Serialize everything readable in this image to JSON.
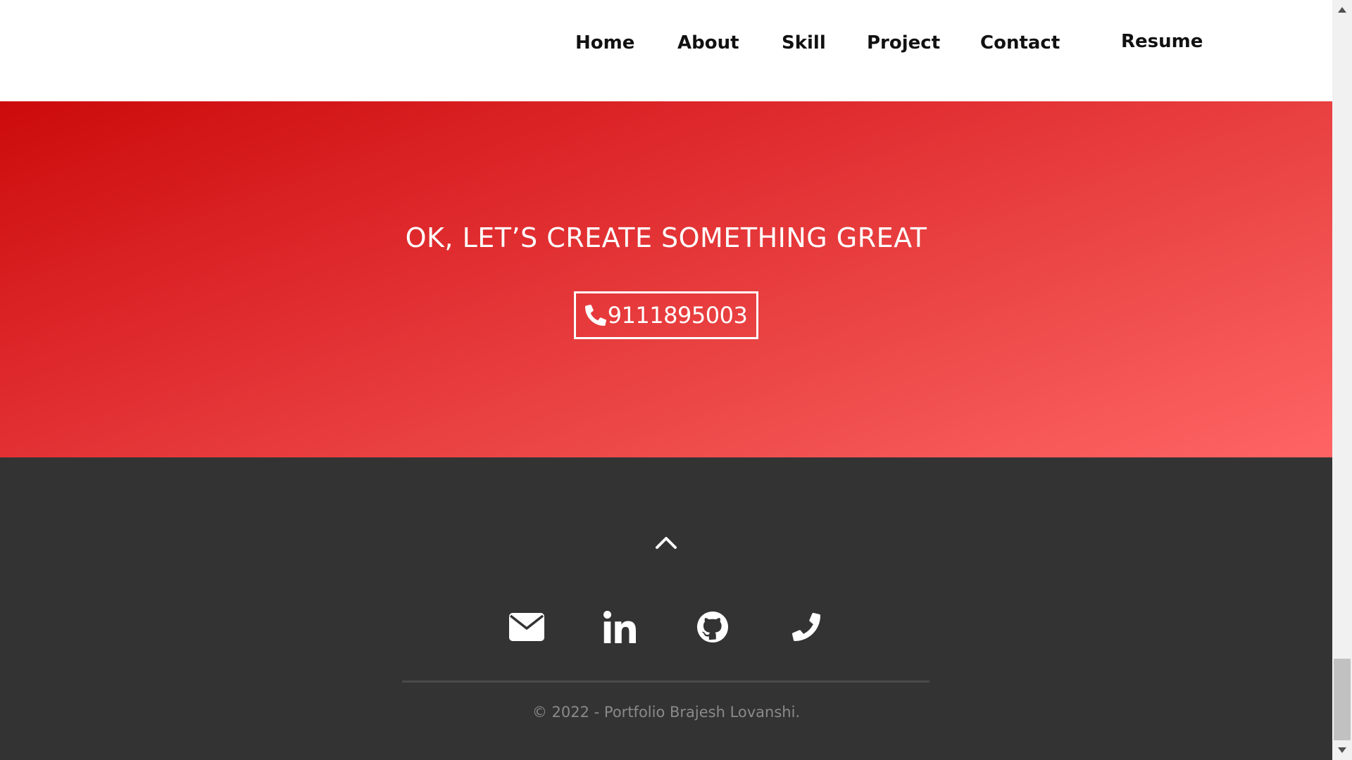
{
  "nav": {
    "items": [
      {
        "label": "Home"
      },
      {
        "label": "About"
      },
      {
        "label": "Skill"
      },
      {
        "label": "Project"
      },
      {
        "label": "Contact"
      }
    ],
    "resume_label": "Resume"
  },
  "cta": {
    "heading": "OK, LET’S CREATE SOMETHING GREAT",
    "phone": "9111895003",
    "icon": "phone-icon"
  },
  "footer": {
    "back_to_top_icon": "chevron-up-icon",
    "social_icons": [
      "envelope-icon",
      "linkedin-icon",
      "github-icon",
      "phone-icon"
    ],
    "copyright": "© 2022 - Portfolio Brajesh Lovanshi."
  },
  "colors": {
    "accent_red": "#df2a2d",
    "footer_bg": "#333333",
    "nav_bg": "#ffffff"
  }
}
